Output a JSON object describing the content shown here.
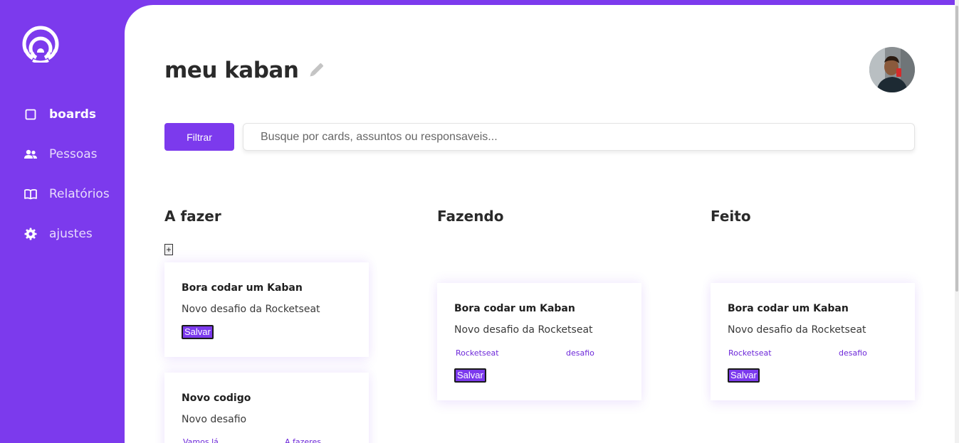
{
  "sidebar": {
    "items": [
      {
        "label": "boards",
        "icon": "square-icon",
        "active": true
      },
      {
        "label": "Pessoas",
        "icon": "people-icon",
        "active": false
      },
      {
        "label": "Relatórios",
        "icon": "book-icon",
        "active": false
      },
      {
        "label": "ajustes",
        "icon": "gear-icon",
        "active": false
      }
    ]
  },
  "header": {
    "title": "meu kaban"
  },
  "toolbar": {
    "filter_label": "Filtrar",
    "search_placeholder": "Busque por cards, assuntos ou responsaveis..."
  },
  "columns": [
    {
      "title": "A fazer",
      "add_label": "+",
      "cards": [
        {
          "title": "Bora codar um Kaban",
          "description": "Novo desafio da Rocketseat",
          "tags": [],
          "save_label": "Salvar"
        },
        {
          "title": "Novo codigo",
          "description": "Novo desafio",
          "tags": [
            "Vamos lá",
            "A fazeres"
          ]
        }
      ]
    },
    {
      "title": "Fazendo",
      "cards": [
        {
          "title": "Bora codar um Kaban",
          "description": "Novo desafio da Rocketseat",
          "tags": [
            "Rocketseat",
            "desafio"
          ],
          "save_label": "Salvar"
        }
      ]
    },
    {
      "title": "Feito",
      "cards": [
        {
          "title": "Bora codar um Kaban",
          "description": "Novo desafio da Rocketseat",
          "tags": [
            "Rocketseat",
            "desafio"
          ],
          "save_label": "Salvar"
        }
      ]
    }
  ],
  "colors": {
    "accent": "#7c3aed",
    "background": "#ffffff",
    "text": "#2a2a2a"
  }
}
